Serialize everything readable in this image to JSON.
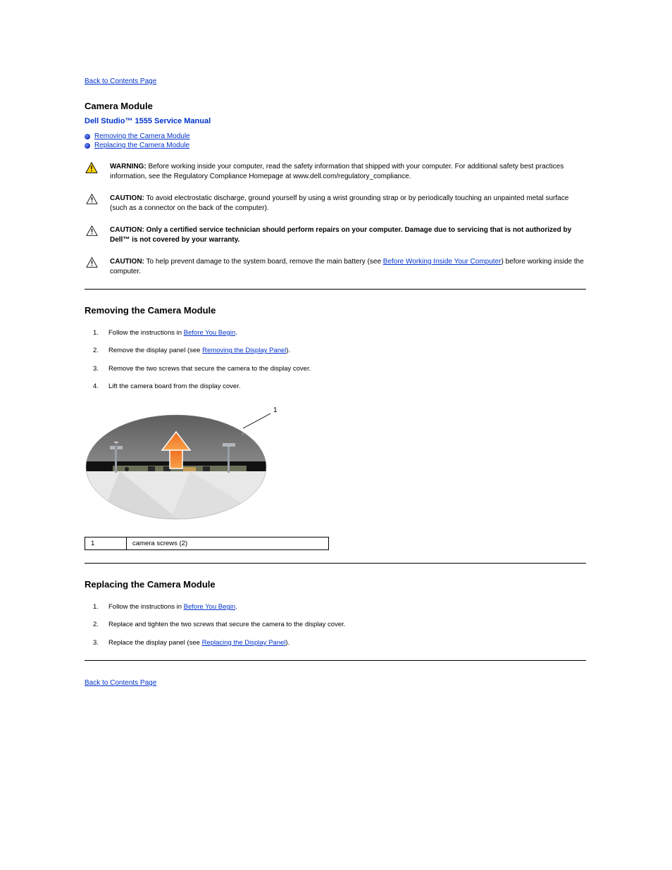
{
  "nav": {
    "back_top": "Back to Contents Page",
    "back_bottom": "Back to Contents Page"
  },
  "header": {
    "module_title": "Camera Module",
    "manual_title": "Dell Studio™ 1555 Service Manual"
  },
  "toc": {
    "item1": "Removing the Camera Module",
    "item2": "Replacing the Camera Module"
  },
  "notices": {
    "warning_label": "WARNING:",
    "warning_text": " Before working inside your computer, read the safety information that shipped with your computer. For additional safety best practices information, see the Regulatory Compliance Homepage at www.dell.com/regulatory_compliance.",
    "esd_label": "CAUTION:",
    "esd_text": " To avoid electrostatic discharge, ground yourself by using a wrist grounding strap or by periodically touching an unpainted metal surface (such as a connector on the back of the computer).",
    "cert_label": "CAUTION:",
    "cert_text_before": " ",
    "cert_text_bold": "Only a certified service technician should perform repairs on your computer. Damage due to servicing that is not authorized by Dell™ is not covered by your warranty.",
    "sysboard_label": "CAUTION:",
    "sysboard_text_before": " To help prevent damage to the system board, remove the main battery (see ",
    "sysboard_link": "Before Working Inside Your Computer",
    "sysboard_text_after": ") before working inside the computer."
  },
  "remove": {
    "heading": "Removing the Camera Module",
    "step1_pre": "Follow the instructions in ",
    "step1_link": "Before You Begin",
    "step1_post": ".",
    "step2_pre": "Remove the display panel (see ",
    "step2_link": "Removing the Display Panel",
    "step2_post": ").",
    "step3": "Remove the two screws that secure the camera to the display cover.",
    "step4": "Lift the camera board from the display cover."
  },
  "callout": {
    "num": "1",
    "label": "1",
    "text": "camera screws (2)"
  },
  "replace": {
    "heading": "Replacing the Camera Module",
    "step1_pre": "Follow the instructions in ",
    "step1_link": "Before You Begin",
    "step1_post": ".",
    "step2": "Replace and tighten the two screws that secure the camera to the display cover.",
    "step3_pre": "Replace the display panel (see ",
    "step3_link": "Replacing the Display Panel",
    "step3_post": ")."
  }
}
